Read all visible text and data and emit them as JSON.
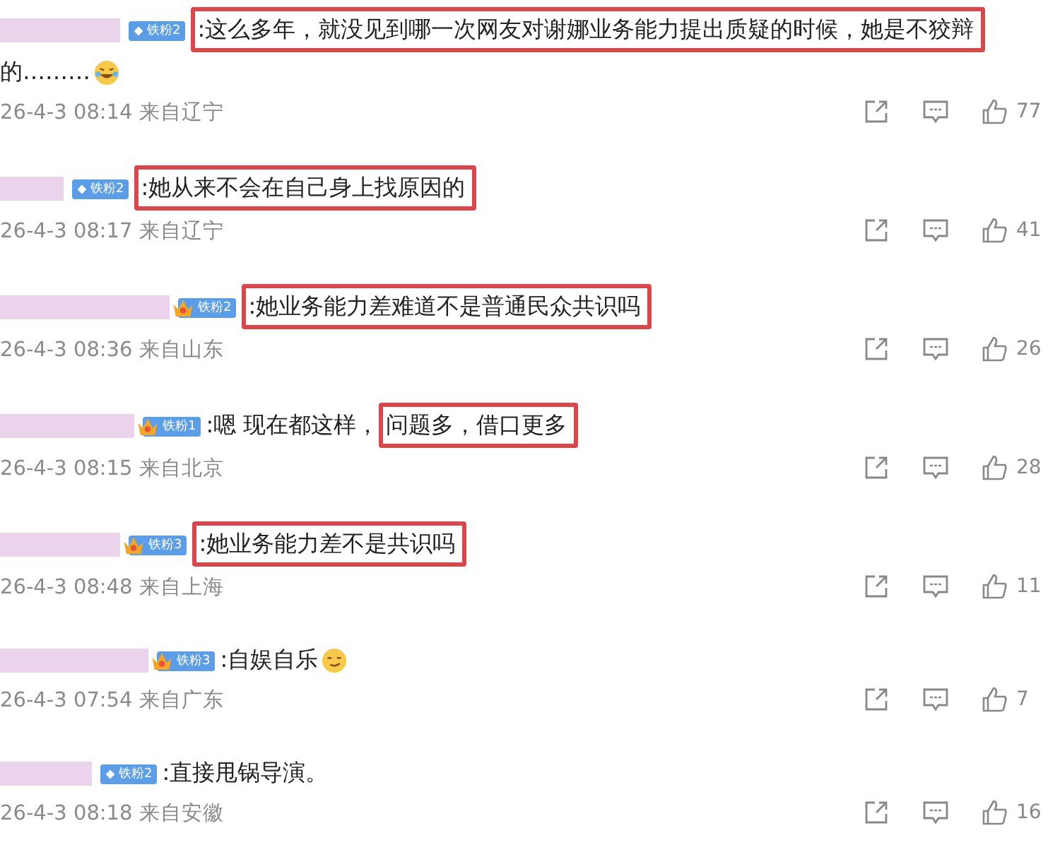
{
  "comments": [
    {
      "badge": {
        "kind": "diamond",
        "label": "铁粉2"
      },
      "segments": [
        {
          "text": ":这么多年，就没见到哪一次网友对谢娜业务能力提出质疑的时候，她是不狡辩",
          "highlighted": true
        },
        {
          "text": "的………",
          "highlighted": false
        }
      ],
      "emoji": {
        "kind": "laughing"
      },
      "meta": "26-4-3 08:14 来自辽宁",
      "likes": "77"
    },
    {
      "badge": {
        "kind": "diamond",
        "label": "铁粉2"
      },
      "segments": [
        {
          "text": ":她从来不会在自己身上找原因的",
          "highlighted": true
        }
      ],
      "meta": "26-4-3 08:17 来自辽宁",
      "likes": "41"
    },
    {
      "badge": {
        "kind": "crown",
        "label": "铁粉2"
      },
      "segments": [
        {
          "text": ":她业务能力差难道不是普通民众共识吗",
          "highlighted": true
        }
      ],
      "meta": "26-4-3 08:36 来自山东",
      "likes": "26"
    },
    {
      "badge": {
        "kind": "crown",
        "label": "铁粉1"
      },
      "segments": [
        {
          "text": ":嗯 现在都这样，",
          "highlighted": false
        },
        {
          "text": "问题多，借口更多",
          "highlighted": true
        }
      ],
      "meta": "26-4-3 08:15 来自北京",
      "likes": "28"
    },
    {
      "badge": {
        "kind": "crown",
        "label": "铁粉3"
      },
      "segments": [
        {
          "text": ":她业务能力差不是共识吗",
          "highlighted": true
        }
      ],
      "meta": "26-4-3 08:48 来自上海",
      "likes": "11"
    },
    {
      "badge": {
        "kind": "crown",
        "label": "铁粉3"
      },
      "segments": [
        {
          "text": ":自娱自乐",
          "highlighted": false
        }
      ],
      "emoji": {
        "kind": "smirking"
      },
      "meta": "26-4-3 07:54 来自广东",
      "likes": "7"
    },
    {
      "badge": {
        "kind": "diamond",
        "label": "铁粉2"
      },
      "segments": [
        {
          "text": ":直接甩锅导演。",
          "highlighted": false
        }
      ],
      "meta": "26-4-3 08:18 来自安徽",
      "likes": "16"
    }
  ]
}
